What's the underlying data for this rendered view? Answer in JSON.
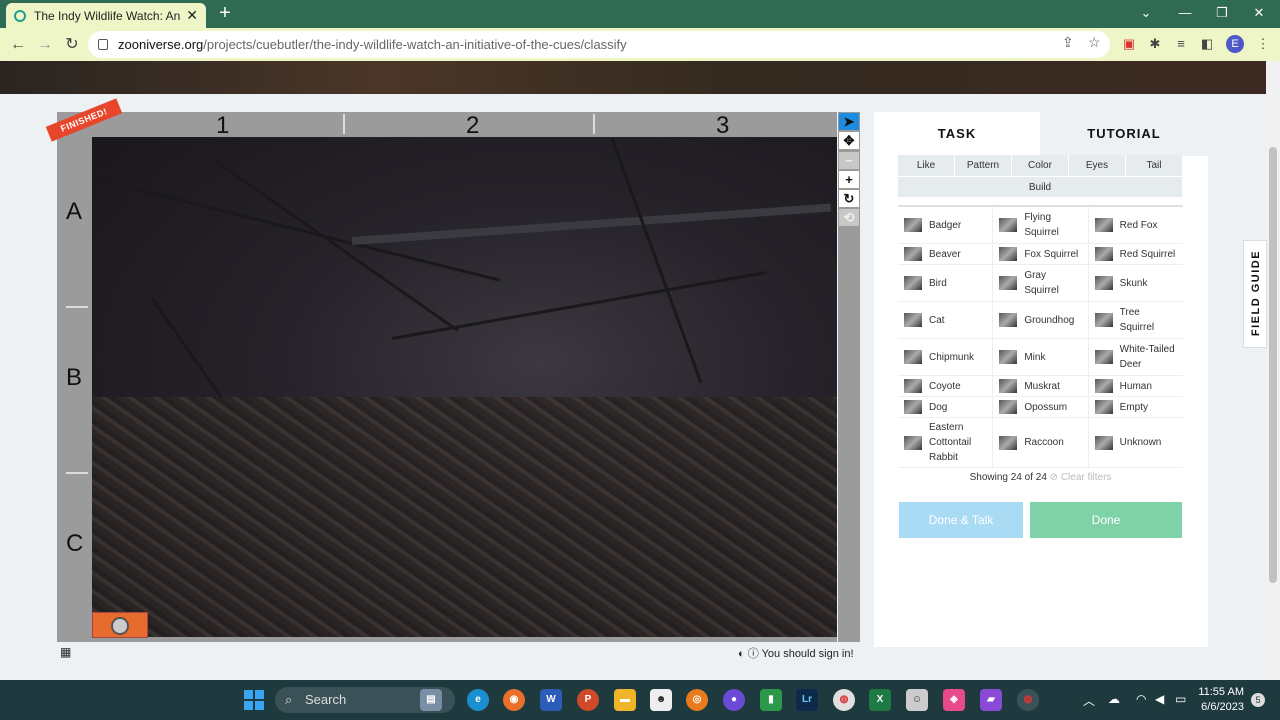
{
  "browser": {
    "tab_title": "The Indy Wildlife Watch: An Initia",
    "url_host": "zooniverse.org",
    "url_path": "/projects/cuebutler/the-indy-wildlife-watch-an-initiative-of-the-cues/classify",
    "profile_initial": "E"
  },
  "viewer": {
    "finished_badge": "FINISHED!",
    "columns": [
      "1",
      "2",
      "3"
    ],
    "rows": [
      "A",
      "B",
      "C"
    ],
    "signin_text": "You should sign in!"
  },
  "panel": {
    "tab_task": "TASK",
    "tab_tutorial": "TUTORIAL",
    "filters_row1": [
      "Like",
      "Pattern",
      "Color",
      "Eyes",
      "Tail"
    ],
    "filters_row2": [
      "Build"
    ],
    "species": [
      [
        "Badger",
        "Flying Squirrel",
        "Red Fox"
      ],
      [
        "Beaver",
        "Fox Squirrel",
        "Red Squirrel"
      ],
      [
        "Bird",
        "Gray Squirrel",
        "Skunk"
      ],
      [
        "Cat",
        "Groundhog",
        "Tree Squirrel"
      ],
      [
        "Chipmunk",
        "Mink",
        "White-Tailed Deer"
      ],
      [
        "Coyote",
        "Muskrat",
        "Human"
      ],
      [
        "Dog",
        "Opossum",
        "Empty"
      ],
      [
        "Eastern Cottontail Rabbit",
        "Raccoon",
        "Unknown"
      ]
    ],
    "showing": "Showing 24 of 24",
    "clear_filters": "Clear filters",
    "btn_done_talk": "Done & Talk",
    "btn_done": "Done",
    "field_guide": "FIELD GUIDE"
  },
  "taskbar": {
    "search_label": "Search",
    "time": "11:55 AM",
    "date": "6/6/2023",
    "notifications": "5"
  },
  "colors": {
    "tabbar": "#2f6a52",
    "toolbar": "#eef6c8",
    "done_talk": "#a9dcf4",
    "done": "#7fd2a8",
    "finished_badge": "#e8462a",
    "active_tool": "#1c8be0"
  }
}
